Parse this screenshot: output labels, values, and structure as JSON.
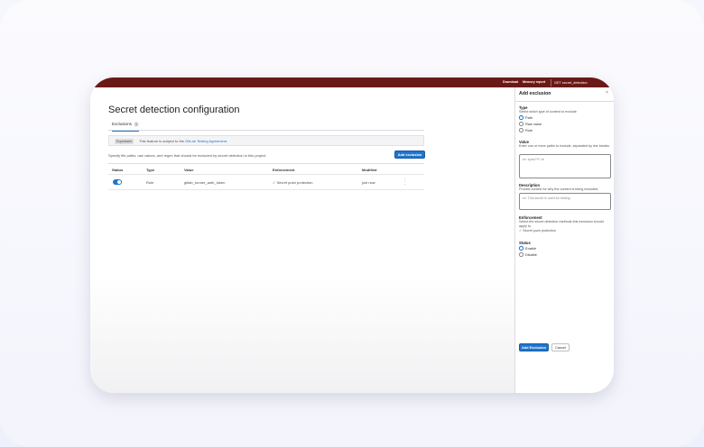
{
  "topbar": {
    "links": [
      "Download",
      "Memory report"
    ],
    "tag": "GET secret_detection"
  },
  "page": {
    "title": "Secret detection configuration",
    "tab_label": "Exclusions",
    "tab_count": "1",
    "alert_badge": "Experiment",
    "alert_text": "This feature is subject to the",
    "alert_link": "GitLab Testing Agreement",
    "alert_end": ".",
    "description": "Specify file paths, raw values, and regex that should be excluded by secret detection in this project.",
    "add_button": "Add exclusion"
  },
  "table": {
    "headers": [
      "Status",
      "Type",
      "Value",
      "Enforcement",
      "Modified"
    ],
    "rows": [
      {
        "status_enabled": true,
        "type": "Rule",
        "value": "gitlab_runner_auth_token",
        "enforcement": "✓ Secret push protection",
        "modified": "just now"
      }
    ]
  },
  "drawer": {
    "title": "Add exclusion",
    "close_icon": "×",
    "type_label": "Type",
    "type_help": "Select which type of content to exclude",
    "type_options": [
      "Path",
      "Raw value",
      "Rule"
    ],
    "type_selected": "Path",
    "value_label": "Value",
    "value_help": "Enter one or more paths to exclude, separated by line breaks.",
    "value_placeholder": "ex: spec/**/*.rb",
    "description_label": "Description",
    "description_help": "Provide context for why the content is being excluded.",
    "description_placeholder": "ex: This secret is used for testing",
    "enforcement_label": "Enforcement",
    "enforcement_help": "Select the secret detection methods this exclusion should apply to.",
    "enforcement_option": "✓ Secret push protection",
    "status_label": "Status",
    "status_options": [
      "Enable",
      "Disable"
    ],
    "status_selected": "Enable",
    "submit_button": "Add Exclusion",
    "cancel_button": "Cancel"
  },
  "colors": {
    "topbar": "#6a1a16",
    "accent": "#1f75cb"
  }
}
